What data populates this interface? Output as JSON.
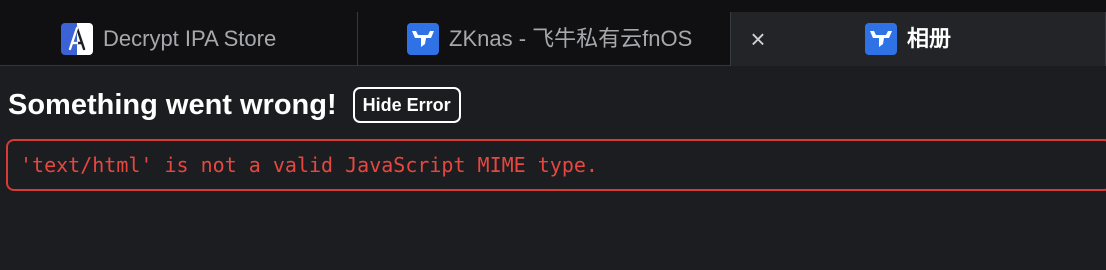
{
  "tabs": [
    {
      "title": "Decrypt IPA Store",
      "icon": "decrypt-ipa-app-icon",
      "active": false
    },
    {
      "title": "ZKnas - 飞牛私有云fnOS",
      "icon": "fnos-bull-icon",
      "active": false
    },
    {
      "title": "相册",
      "icon": "fnos-bull-icon",
      "active": true,
      "close_glyph": "×"
    }
  ],
  "error": {
    "title": "Something went wrong!",
    "hide_button_label": "Hide Error",
    "message": "'text/html' is not a valid JavaScript MIME type."
  },
  "colors": {
    "background": "#1c1d21",
    "tabbar": "#101012",
    "active_tab": "#232428",
    "error_red": "#e8473f",
    "fnos_blue": "#2f72e6"
  }
}
